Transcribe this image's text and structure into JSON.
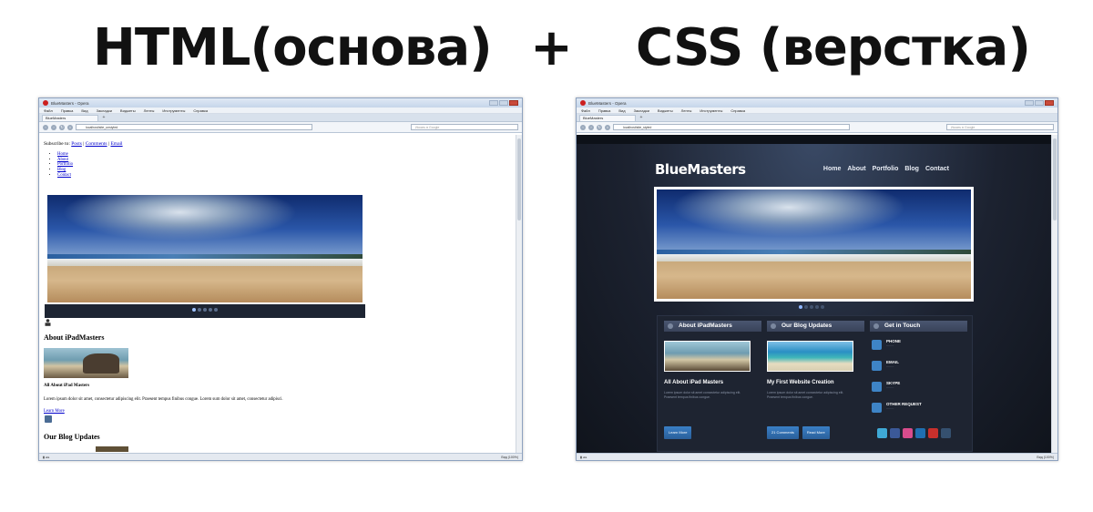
{
  "heading": {
    "left": "HTML(основа)",
    "plus": "+",
    "right": "CSS (верстка)"
  },
  "browser_left": {
    "window_title": "BlueMasters - Opera",
    "menu": [
      "Файл",
      "Правка",
      "Вид",
      "Закладки",
      "Виджеты",
      "Ленты",
      "Инструменты",
      "Справка"
    ],
    "tab_label": "BlueMasters",
    "tab_add": "+",
    "url": "localhost/site_unstyled",
    "search_placeholder": "Искать в Google",
    "status_zoom": "Вид (100%)",
    "page": {
      "subscribe_label": "Subscribe to:",
      "subscribe_links": [
        "Posts",
        "Comments",
        "Email"
      ],
      "nav_links": [
        "Home",
        "About",
        "Portfolio",
        "Blog",
        "Contact"
      ],
      "about_heading": "About iPadMasters",
      "about_title": "All About iPad Masters",
      "about_text": "Lorem ipsum dolor sit amet, consectetur adipiscing elit. Praesent tempus finibus congue. Lorem sum dolor sit amet, consectetur adipisci.",
      "learn_more": "Learn More",
      "updates_heading": "Our Blog Updates"
    }
  },
  "browser_right": {
    "window_title": "BlueMasters - Opera",
    "menu": [
      "Файл",
      "Правка",
      "Вид",
      "Закладки",
      "Виджеты",
      "Ленты",
      "Инструменты",
      "Справка"
    ],
    "tab_label": "BlueMasters",
    "tab_add": "+",
    "url": "localhost/site_styled",
    "search_placeholder": "Искать в Google",
    "status_zoom": "Вид (100%)",
    "site": {
      "logo": "BlueMasters",
      "nav": [
        "Home",
        "About",
        "Portfolio",
        "Blog",
        "Contact"
      ],
      "about": {
        "heading": "About iPadMasters",
        "title": "All About iPad Masters",
        "text": "Lorem ipsum dolor sit amet consectetur adipiscing elit. Praesent tempus finibus congue.",
        "button": "Learn More"
      },
      "blog": {
        "heading": "Our Blog Updates",
        "title": "My First Website Creation",
        "text": "Lorem ipsum dolor sit amet consectetur adipiscing elit. Praesent tempus finibus congue.",
        "buttons": [
          "21 Comments",
          "Read More"
        ]
      },
      "touch": {
        "heading": "Get in Touch",
        "items": [
          {
            "title": "PHONE"
          },
          {
            "title": "EMAIL"
          },
          {
            "title": "SKYPE"
          },
          {
            "title": "OTHER REQUEST"
          }
        ]
      }
    }
  },
  "colors": {
    "site_accent": "#3e84c6",
    "site_bg": "#1c2230",
    "link_blue": "#0000cc"
  },
  "icons": [
    "opera-logo-icon",
    "back-icon",
    "forward-icon",
    "reload-icon",
    "home-icon",
    "person-icon",
    "feed-icon",
    "phone-icon",
    "email-icon",
    "skype-icon",
    "request-icon",
    "twitter-icon",
    "facebook-icon",
    "flickr-icon",
    "linkedin-icon",
    "youtube-icon",
    "tumblr-icon"
  ]
}
